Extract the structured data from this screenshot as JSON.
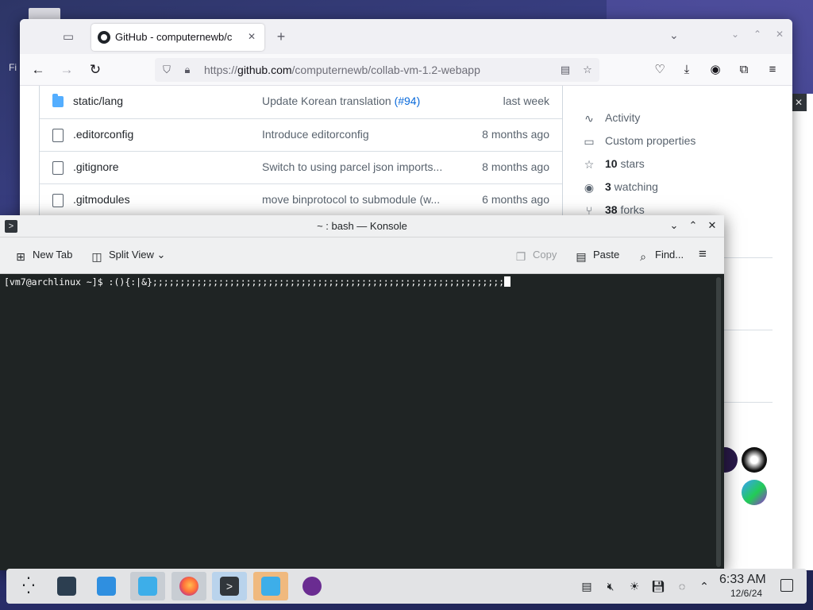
{
  "desktop": {
    "partial_label": "Fi"
  },
  "firefox": {
    "tab_title": "GitHub - computernewb/c",
    "tab_close": "✕",
    "new_tab": "+",
    "url_prefix": "https://",
    "url_host": "github.com",
    "url_path": "/computernewb/collab-vm-1.2-webapp"
  },
  "github": {
    "files": [
      {
        "name": "static/lang",
        "type": "folder",
        "message": "Update Korean translation ",
        "pr": "(#94)",
        "date": "last week"
      },
      {
        "name": ".editorconfig",
        "type": "file",
        "message": "Introduce editorconfig",
        "pr": "",
        "date": "8 months ago"
      },
      {
        "name": ".gitignore",
        "type": "file",
        "message": "Switch to using parcel json imports...",
        "pr": "",
        "date": "8 months ago"
      },
      {
        "name": ".gitmodules",
        "type": "file",
        "message": "move binprotocol to submodule (w...",
        "pr": "",
        "date": "6 months ago"
      }
    ],
    "about": {
      "activity": "Activity",
      "custom_properties": "Custom properties",
      "stars_count": "10",
      "stars_label": " stars",
      "watching_count": "3",
      "watching_label": " watching",
      "forks_count": "38",
      "forks_label": " forks"
    }
  },
  "konsole": {
    "title": "~ : bash — Konsole",
    "new_tab": "New Tab",
    "split_view": "Split View",
    "copy": "Copy",
    "paste": "Paste",
    "find": "Find...",
    "prompt_line": "[vm7@archlinux ~]$ :(){:|&};;;;;;;;;;;;;;;;;;;;;;;;;;;;;;;;;;;;;;;;;;;;;;;;;;;;;;;;;;;;;;;;"
  },
  "panel": {
    "time": "6:33 AM",
    "date": "12/6/24"
  }
}
